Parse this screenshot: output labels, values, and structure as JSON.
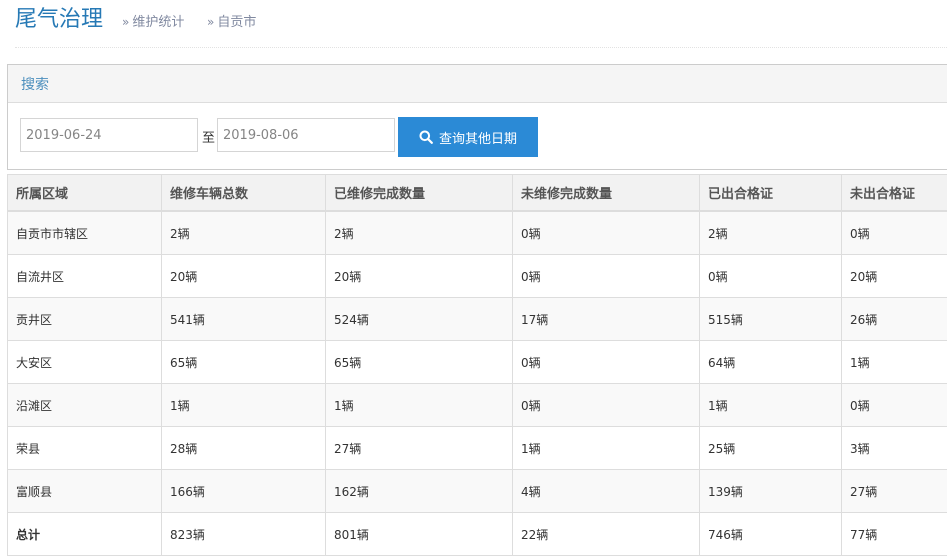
{
  "header": {
    "title": "尾气治理",
    "breadcrumbs": [
      "维护统计",
      "自贡市"
    ]
  },
  "search": {
    "title": "搜索",
    "start_date": "2019-06-24",
    "to_label": "至",
    "end_date": "2019-08-06",
    "button_label": "查询其他日期",
    "button_icon": "search-icon",
    "button_color": "#2b8ad6"
  },
  "table": {
    "columns": [
      "所属区域",
      "维修车辆总数",
      "已维修完成数量",
      "未维修完成数量",
      "已出合格证",
      "未出合格证"
    ],
    "rows": [
      [
        "自贡市市辖区",
        "2辆",
        "2辆",
        "0辆",
        "2辆",
        "0辆"
      ],
      [
        "自流井区",
        "20辆",
        "20辆",
        "0辆",
        "0辆",
        "20辆"
      ],
      [
        "贡井区",
        "541辆",
        "524辆",
        "17辆",
        "515辆",
        "26辆"
      ],
      [
        "大安区",
        "65辆",
        "65辆",
        "0辆",
        "64辆",
        "1辆"
      ],
      [
        "沿滩区",
        "1辆",
        "1辆",
        "0辆",
        "1辆",
        "0辆"
      ],
      [
        "荣县",
        "28辆",
        "27辆",
        "1辆",
        "25辆",
        "3辆"
      ],
      [
        "富顺县",
        "166辆",
        "162辆",
        "4辆",
        "139辆",
        "27辆"
      ],
      [
        "总计",
        "823辆",
        "801辆",
        "22辆",
        "746辆",
        "77辆"
      ]
    ]
  },
  "colors": {
    "title": "#2679b5",
    "search_title": "#4c8fbd"
  }
}
